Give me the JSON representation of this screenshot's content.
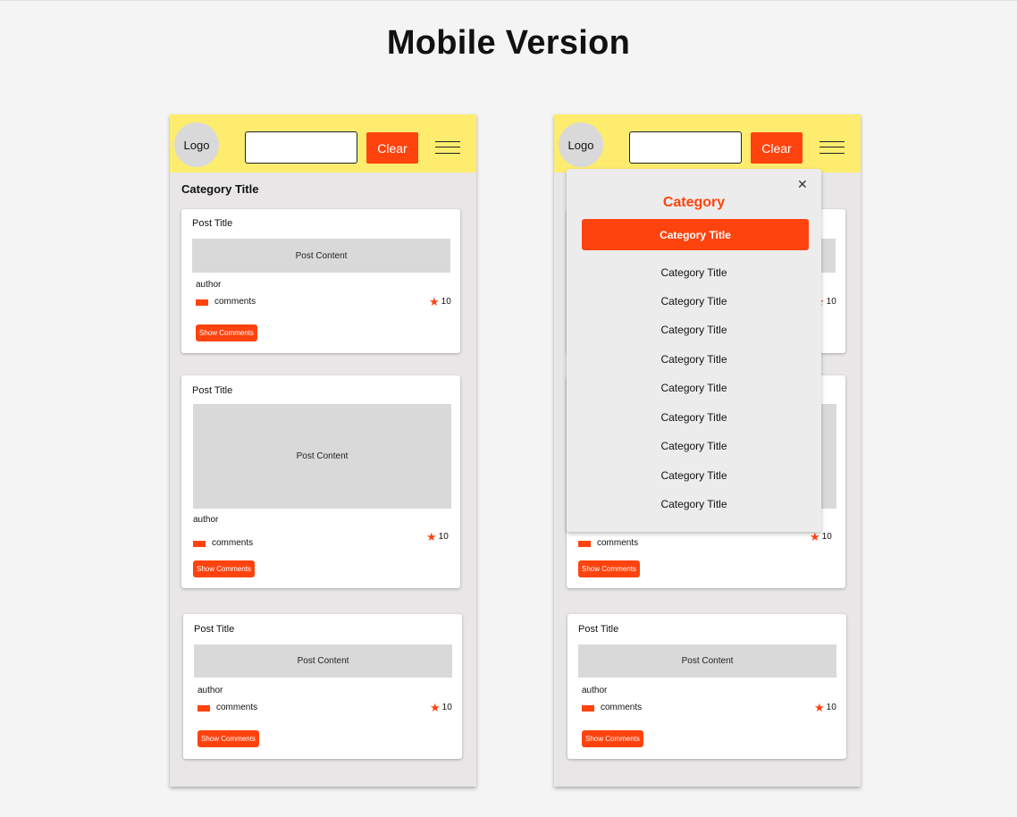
{
  "page": {
    "title": "Mobile Version"
  },
  "header": {
    "logo": "Logo",
    "search_value": "",
    "clear_label": "Clear"
  },
  "feed": {
    "category_title": "Category Title",
    "posts": [
      {
        "title": "Post Title",
        "content": "Post Content",
        "author": "author",
        "comments_label": "comments",
        "rating": "10",
        "show_comments_label": "Show Comments"
      },
      {
        "title": "Post Title",
        "content": "Post Content",
        "author": "author",
        "comments_label": "comments",
        "rating": "10",
        "show_comments_label": "Show Comments"
      },
      {
        "title": "Post Title",
        "content": "Post Content",
        "author": "author",
        "comments_label": "comments",
        "rating": "10",
        "show_comments_label": "Show Comments"
      }
    ]
  },
  "dropdown": {
    "heading": "Category",
    "active_item": "Category Title",
    "items": [
      "Category Title",
      "Category Title",
      "Category Title",
      "Category Title",
      "Category Title",
      "Category Title",
      "Category Title",
      "Category Title",
      "Category Title"
    ]
  },
  "colors": {
    "accent": "#ff430f",
    "header": "#fdec6e",
    "placeholder": "#d9d9d9",
    "phone_bg": "#e8e6e6"
  },
  "icons": [
    "close-icon",
    "menu-icon",
    "star-icon",
    "comment-icon"
  ]
}
